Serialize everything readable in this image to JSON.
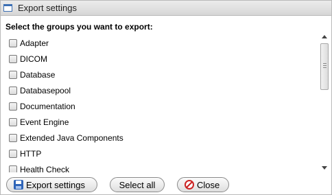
{
  "window": {
    "title": "Export settings"
  },
  "heading": "Select the groups you want to export:",
  "groups": [
    {
      "label": "Adapter",
      "checked": false
    },
    {
      "label": "DICOM",
      "checked": false
    },
    {
      "label": "Database",
      "checked": false
    },
    {
      "label": "Databasepool",
      "checked": false
    },
    {
      "label": "Documentation",
      "checked": false
    },
    {
      "label": "Event Engine",
      "checked": false
    },
    {
      "label": "Extended Java Components",
      "checked": false
    },
    {
      "label": "HTTP",
      "checked": false
    },
    {
      "label": "Health Check",
      "checked": false
    }
  ],
  "buttons": {
    "export_label": "Export settings",
    "select_all_label": "Select all",
    "close_label": "Close"
  },
  "icons": {
    "window": "window-icon",
    "export": "floppy-disk-icon",
    "close": "no-entry-icon"
  },
  "colors": {
    "accent": "#2e64b8",
    "close_icon": "#cc2222"
  }
}
